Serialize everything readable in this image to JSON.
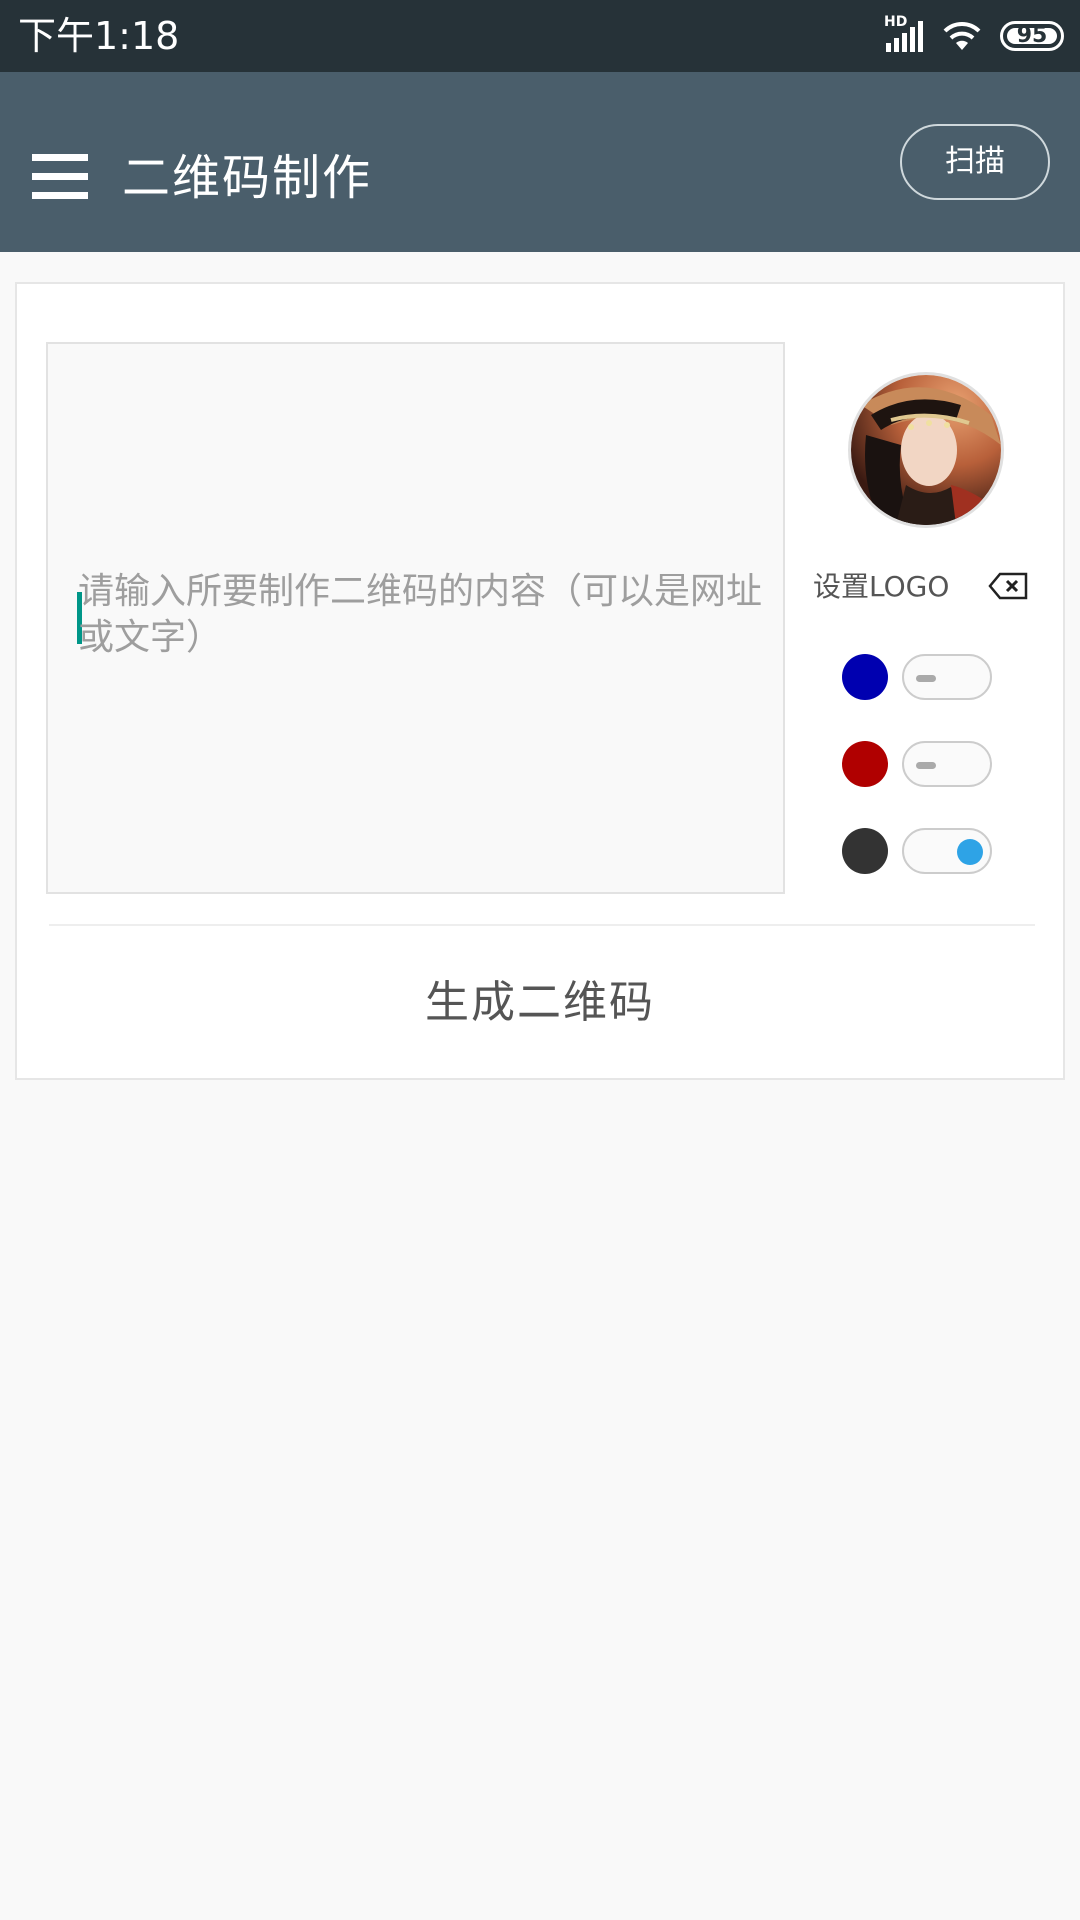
{
  "status_bar": {
    "time": "下午1:18",
    "network_label": "HD",
    "battery_level": "95"
  },
  "app_bar": {
    "title": "二维码制作",
    "scan_label": "扫描",
    "menu_icon": "hamburger-menu-icon"
  },
  "form": {
    "content_placeholder": "请输入所要制作二维码的内容（可以是网址或文字）",
    "content_value": "",
    "logo_label": "设置LOGO",
    "clear_logo_icon": "backspace-icon",
    "colors": [
      {
        "color": "#0000b0",
        "enabled": false
      },
      {
        "color": "#b00000",
        "enabled": false
      },
      {
        "color": "#333333",
        "enabled": true
      }
    ]
  },
  "actions": {
    "generate_label": "生成二维码"
  },
  "theme": {
    "status_bar_bg": "#263238",
    "app_bar_bg": "#4a5e6b",
    "accent": "#2ea3e6",
    "caret": "#009688"
  }
}
